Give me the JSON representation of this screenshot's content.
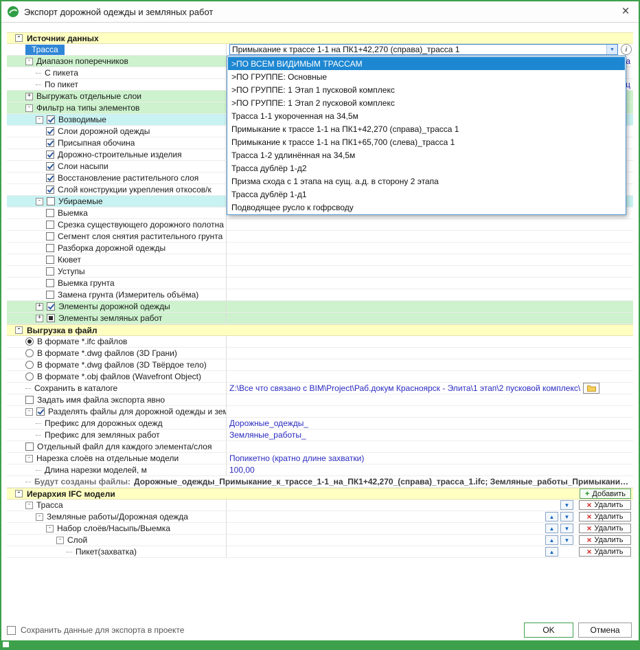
{
  "window": {
    "title": "Экспорт дорожной одежды и земляных работ",
    "close_glyph": "×"
  },
  "combo": {
    "value": "Примыкание к трассе 1-1 на ПК1+42,270 (справа)_трасса 1",
    "arrow": "▼",
    "info": "i"
  },
  "dropdown": {
    "selected_index": 0,
    "items": [
      ">ПО ВСЕМ ВИДИМЫМ ТРАССАМ",
      ">ПО ГРУППЕ: Основные",
      ">ПО ГРУППЕ: 1 Этап 1 пусковой комплекс",
      ">ПО ГРУППЕ: 1 Этап 2 пусковой комплекс",
      "Трасса 1-1 укороченная на 34,5м",
      "Примыкание к трассе 1-1 на ПК1+42,270 (справа)_трасса 1",
      "Примыкание к трассе 1-1 на ПК1+65,700 (слева)_трасса 1",
      "Трасса 1-2 удлинённая на 34,5м",
      "Трасса дублёр 1-д2",
      "Призма схода с 1 этапа на сущ. а.д. в сторону 2 этапа",
      "Трасса дублёр 1-д1",
      "Подводящее русло к гофрсводу"
    ]
  },
  "hierarchy": {
    "add_label": "Добавить",
    "add_plus": "+",
    "delete_label": "Удалить",
    "delete_x": "×",
    "up_glyph": "▲",
    "down_glyph": "▼"
  },
  "footer": {
    "save_label": "Сохранить данные для экспорта в проекте",
    "ok_label": "OK",
    "cancel_label": "Отмена"
  },
  "grid": {
    "rows": [
      {
        "name": "section-source",
        "kind": "section",
        "label": "Источник данных",
        "exp": "minus"
      },
      {
        "name": "row-trassa",
        "label": "Трасса",
        "level": 1,
        "sel": true,
        "widget": "combo"
      },
      {
        "name": "row-cross-section-range",
        "label": "Диапазон поперечников",
        "level": 1,
        "exp": "minus",
        "bg": "green-left",
        "value": "са",
        "vstyle": "fragment"
      },
      {
        "name": "row-from-picket",
        "label": "С пикета",
        "level": 2,
        "dash": true
      },
      {
        "name": "row-to-picket",
        "label": "По пикет",
        "level": 2,
        "dash": true,
        "value": "ец",
        "vstyle": "fragment"
      },
      {
        "name": "row-export-separate-layers",
        "label": "Выгружать отдельные слои",
        "level": 1,
        "exp": "plus",
        "bg": "green"
      },
      {
        "name": "row-element-type-filter",
        "label": "Фильтр на типы элементов",
        "level": 1,
        "exp": "minus",
        "bg": "green"
      },
      {
        "name": "row-constructed",
        "label": "Возводимые",
        "level": 2,
        "exp": "minus",
        "ctl": "cb1",
        "bg": "cyan"
      },
      {
        "name": "row-item-pavement-layers",
        "label": "Слои дорожной одежды",
        "level": 3,
        "ctl": "cb1"
      },
      {
        "name": "row-item-shoulder",
        "label": "Присыпная обочина",
        "level": 3,
        "ctl": "cb1"
      },
      {
        "name": "row-item-road-products",
        "label": "Дорожно-строительные изделия",
        "level": 3,
        "ctl": "cb1"
      },
      {
        "name": "row-item-embankment-layers",
        "label": "Слои насыпи",
        "level": 3,
        "ctl": "cb1"
      },
      {
        "name": "row-item-topsoil-restore",
        "label": "Восстановление растительного слоя",
        "level": 3,
        "ctl": "cb1"
      },
      {
        "name": "row-item-slope-reinforcement",
        "label": "Слой конструкции укрепления откосов/к",
        "level": 3,
        "ctl": "cb1"
      },
      {
        "name": "row-removed",
        "label": "Убираемые",
        "level": 2,
        "exp": "minus",
        "ctl": "cb0",
        "bg": "cyan"
      },
      {
        "name": "row-item-excavation",
        "label": "Выемка",
        "level": 3,
        "ctl": "cb0"
      },
      {
        "name": "row-item-existing-road-cut",
        "label": "Срезка существующего дорожного полотна",
        "level": 3,
        "ctl": "cb0"
      },
      {
        "name": "row-item-topsoil-strip-segment",
        "label": "Сегмент слоя снятия растительного грунта",
        "level": 3,
        "ctl": "cb0"
      },
      {
        "name": "row-item-pavement-demolition",
        "label": "Разборка дорожной одежды",
        "level": 3,
        "ctl": "cb0"
      },
      {
        "name": "row-item-ditch",
        "label": "Кювет",
        "level": 3,
        "ctl": "cb0"
      },
      {
        "name": "row-item-benches",
        "label": "Уступы",
        "level": 3,
        "ctl": "cb0"
      },
      {
        "name": "row-item-soil-excavation",
        "label": "Выемка грунта",
        "level": 3,
        "ctl": "cb0"
      },
      {
        "name": "row-item-soil-replacement",
        "label": "Замена грунта (Измеритель объёма)",
        "level": 3,
        "ctl": "cb0"
      },
      {
        "name": "row-pavement-elements",
        "label": "Элементы дорожной одежды",
        "level": 2,
        "exp": "plus",
        "ctl": "cb1",
        "bg": "green"
      },
      {
        "name": "row-earthwork-elements",
        "label": "Элементы земляных работ",
        "level": 2,
        "exp": "plus",
        "ctl": "cbm",
        "bg": "green"
      },
      {
        "name": "section-export",
        "kind": "section",
        "label": "Выгрузка в файл",
        "exp": "minus"
      },
      {
        "name": "row-format-ifc",
        "label": "В формате *.ifc файлов",
        "level": 1,
        "ctl": "r1"
      },
      {
        "name": "row-format-dwg-faces",
        "label": "В формате *.dwg файлов (3D Грани)",
        "level": 1,
        "ctl": "r0"
      },
      {
        "name": "row-format-dwg-solid",
        "label": "В формате *.dwg файлов (3D Твёрдое тело)",
        "level": 1,
        "ctl": "r0"
      },
      {
        "name": "row-format-obj",
        "label": "В формате *.obj файлов (Wavefront Object)",
        "level": 1,
        "ctl": "r0"
      },
      {
        "name": "row-save-directory",
        "label": "Сохранить в каталоге",
        "level": 1,
        "dash": true,
        "value": "Z:\\Все что связано с BIM\\Project\\Раб.докум Красноярск - Элита\\1 этап\\2 пусковой комплекс\\",
        "vstyle": "blue",
        "widget": "folder"
      },
      {
        "name": "row-explicit-file-name",
        "label": "Задать имя файла экспорта явно",
        "level": 1,
        "ctl": "cb0"
      },
      {
        "name": "row-split-files",
        "label": "Разделять файлы для дорожной одежды и земляных работ",
        "level": 1,
        "exp": "minus",
        "ctl": "cb1"
      },
      {
        "name": "row-prefix-pavement",
        "label": "Префикс для дорожных одежд",
        "level": 2,
        "dash": true,
        "value": "Дорожные_одежды_",
        "vstyle": "blue"
      },
      {
        "name": "row-prefix-earthworks",
        "label": "Префикс для земляных работ",
        "level": 2,
        "dash": true,
        "value": "Земляные_работы_",
        "vstyle": "blue"
      },
      {
        "name": "row-separate-file-per-element",
        "label": "Отдельный файл для каждого элемента/слоя",
        "level": 1,
        "ctl": "cb0"
      },
      {
        "name": "row-layer-slicing",
        "label": "Нарезка слоёв на отдельные модели",
        "level": 1,
        "exp": "minus",
        "value": "Попикетно (кратно длине захватки)",
        "vstyle": "blue"
      },
      {
        "name": "row-slice-length",
        "label": "Длина нарезки моделей, м",
        "level": 2,
        "dash": true,
        "value": "100,00",
        "vstyle": "blue"
      },
      {
        "name": "row-files-preview",
        "kind": "files",
        "label": "Будут созданы файлы:",
        "level": 1,
        "value": "Дорожные_одежды_Примыкание_к_трассе_1-1_на_ПК1+42,270_(справа)_трасса_1.ifc; Земляные_работы_Примыкани…"
      },
      {
        "name": "section-ifc-hierarchy",
        "kind": "section",
        "label": "Иерархия IFC модели",
        "exp": "minus",
        "widget": "add"
      },
      {
        "name": "hier-row-trassa",
        "label": "Трасса",
        "level": 1,
        "exp": "minus",
        "widget": "hier",
        "down": true
      },
      {
        "name": "hier-row-earthworks-pavement",
        "label": "Земляные работы/Дорожная одежда",
        "level": 2,
        "exp": "minus",
        "widget": "hier",
        "up": true,
        "down": true
      },
      {
        "name": "hier-row-layerset",
        "label": "Набор слоёв/Насыпь/Выемка",
        "level": 3,
        "exp": "minus",
        "widget": "hier",
        "up": true,
        "down": true
      },
      {
        "name": "hier-row-layer",
        "label": "Слой",
        "level": 4,
        "exp": "minus",
        "widget": "hier",
        "up": true,
        "down": true
      },
      {
        "name": "hier-row-picket",
        "label": "Пикет(захватка)",
        "level": 5,
        "dash": true,
        "widget": "hier",
        "up": true
      }
    ]
  }
}
